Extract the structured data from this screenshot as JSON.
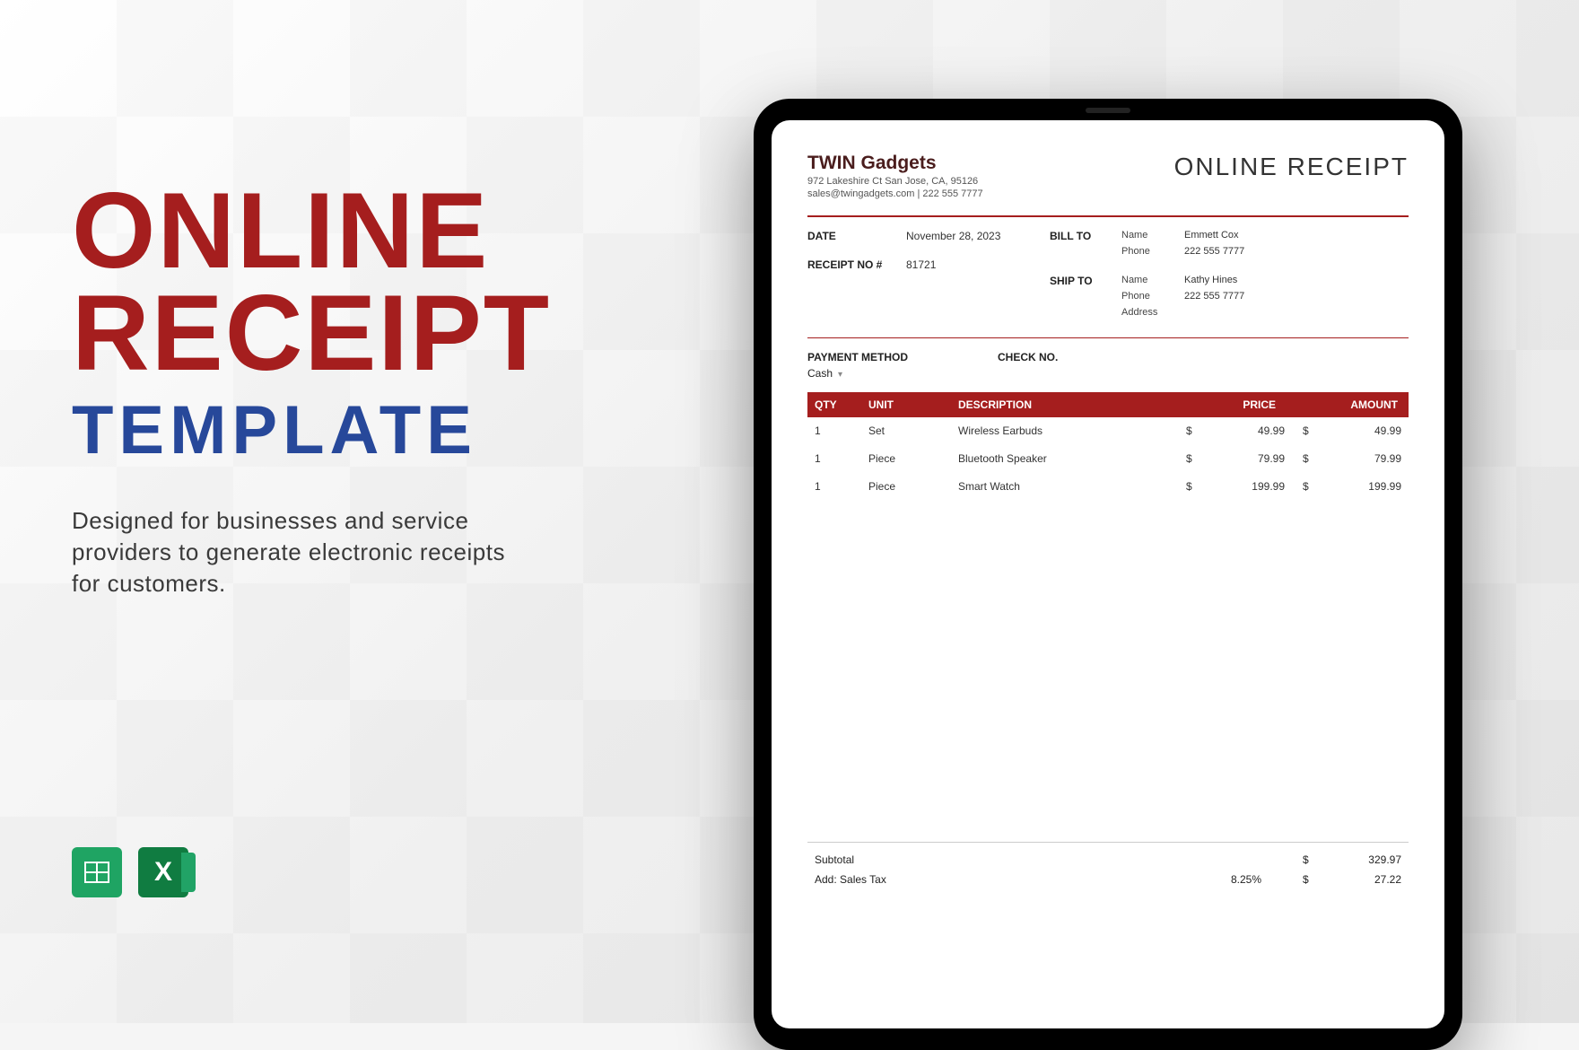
{
  "hero": {
    "title_line1": "ONLINE",
    "title_line2": "RECEIPT",
    "subtitle": "TEMPLATE",
    "description": "Designed for businesses and service providers to generate electronic receipts for customers."
  },
  "apps": {
    "sheets": "Google Sheets",
    "excel": "Excel"
  },
  "receipt": {
    "company_name": "TWIN Gadgets",
    "company_addr": "972 Lakeshire Ct San Jose, CA, 95126",
    "company_contact": "sales@twingadgets.com | 222 555 7777",
    "doc_title": "ONLINE RECEIPT",
    "date_label": "DATE",
    "date": "November 28, 2023",
    "receipt_no_label": "RECEIPT NO #",
    "receipt_no": "81721",
    "bill_to_label": "BILL TO",
    "ship_to_label": "SHIP TO",
    "field_name": "Name",
    "field_phone": "Phone",
    "field_address": "Address",
    "bill_name": "Emmett Cox",
    "bill_phone": "222 555 7777",
    "ship_name": "Kathy Hines",
    "ship_phone": "222 555 7777",
    "payment_method_label": "PAYMENT METHOD",
    "payment_method": "Cash",
    "check_no_label": "CHECK NO.",
    "cols": {
      "qty": "QTY",
      "unit": "UNIT",
      "desc": "DESCRIPTION",
      "price": "PRICE",
      "amount": "AMOUNT"
    },
    "currency": "$",
    "items": [
      {
        "qty": "1",
        "unit": "Set",
        "desc": "Wireless Earbuds",
        "price": "49.99",
        "amount": "49.99"
      },
      {
        "qty": "1",
        "unit": "Piece",
        "desc": "Bluetooth Speaker",
        "price": "79.99",
        "amount": "79.99"
      },
      {
        "qty": "1",
        "unit": "Piece",
        "desc": "Smart Watch",
        "price": "199.99",
        "amount": "199.99"
      }
    ],
    "subtotal_label": "Subtotal",
    "subtotal": "329.97",
    "tax_label": "Add: Sales Tax",
    "tax_rate": "8.25%",
    "tax": "27.22"
  }
}
